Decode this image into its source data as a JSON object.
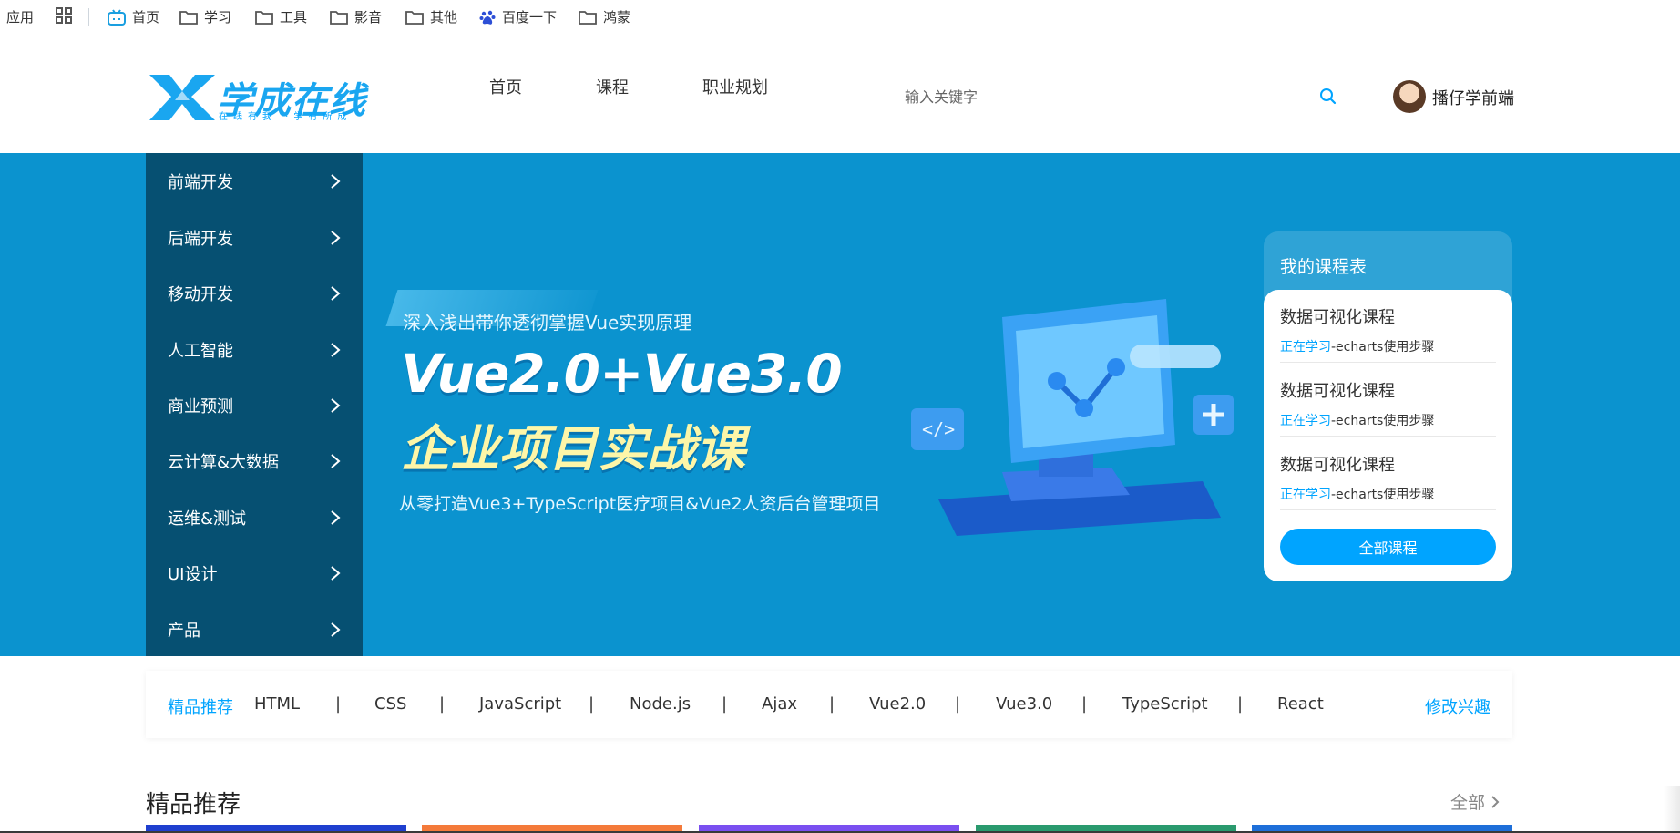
{
  "bookmarks": {
    "apps_label": "应用",
    "items": [
      {
        "label": "首页",
        "icon": "bilibili-icon"
      },
      {
        "label": "学习",
        "icon": "folder-icon"
      },
      {
        "label": "工具",
        "icon": "folder-icon"
      },
      {
        "label": "影音",
        "icon": "folder-icon"
      },
      {
        "label": "其他",
        "icon": "folder-icon"
      },
      {
        "label": "百度一下",
        "icon": "baidu-paw-icon"
      },
      {
        "label": "鸿蒙",
        "icon": "folder-icon"
      }
    ]
  },
  "header": {
    "logo_text": "学成在线",
    "logo_sub": "在线有我 ·学有所成",
    "nav": [
      "首页",
      "课程",
      "职业规划"
    ],
    "search_placeholder": "输入关键字",
    "username": "播仔学前端"
  },
  "side_menu": [
    "前端开发",
    "后端开发",
    "移动开发",
    "人工智能",
    "商业预测",
    "云计算&大数据",
    "运维&测试",
    "UI设计",
    "产品"
  ],
  "promo": {
    "kicker": "深入浅出带你透彻掌握Vue实现原理",
    "title": "Vue2.0+Vue3.0",
    "title2": "企业项目实战课",
    "desc": "从零打造Vue3+TypeScript医疗项目&Vue2人资后台管理项目"
  },
  "my_courses": {
    "title": "我的课程表",
    "items": [
      {
        "name": "数据可视化课程",
        "status": "正在学习",
        "detail": "-echarts使用步骤"
      },
      {
        "name": "数据可视化课程",
        "status": "正在学习",
        "detail": "-echarts使用步骤"
      },
      {
        "name": "数据可视化课程",
        "status": "正在学习",
        "detail": "-echarts使用步骤"
      }
    ],
    "all_button": "全部课程"
  },
  "interests": {
    "label": "精品推荐",
    "tags": [
      "HTML",
      "CSS",
      "JavaScript",
      "Node.js",
      "Ajax",
      "Vue2.0",
      "Vue3.0",
      "TypeScript",
      "React"
    ],
    "separator": "|",
    "edit": "修改兴趣"
  },
  "section": {
    "title": "精品推荐",
    "more": "全部"
  },
  "colors": {
    "brand": "#00a4ff",
    "banner_bg": "#0b93cf",
    "card_colors": [
      "#1f3fcf",
      "#f47a3a",
      "#7a4ff0",
      "#2a9a6e",
      "#1e6fd9"
    ]
  }
}
